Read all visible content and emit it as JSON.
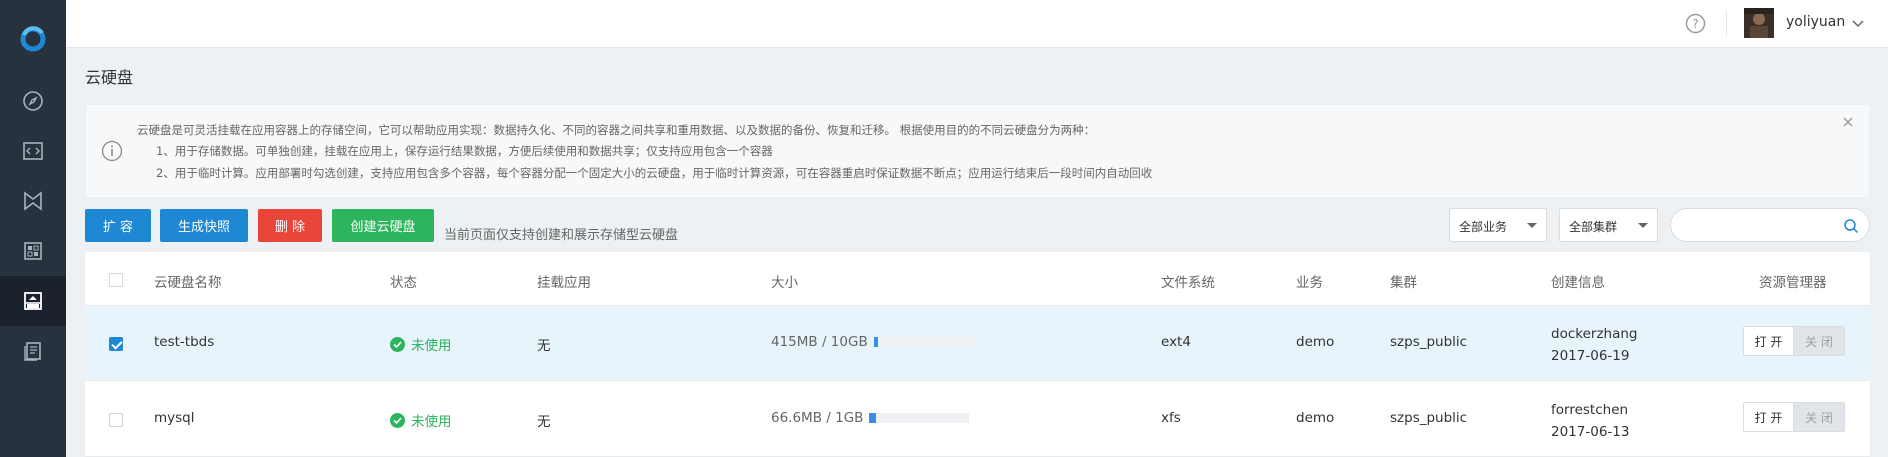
{
  "sidebar": {
    "items": [
      {
        "icon": "compass-icon",
        "active": false
      },
      {
        "icon": "code-icon",
        "active": false
      },
      {
        "icon": "bowtie-icon",
        "active": false
      },
      {
        "icon": "grid-icon",
        "active": false
      },
      {
        "icon": "disk-icon",
        "active": true
      },
      {
        "icon": "document-icon",
        "active": false
      }
    ]
  },
  "header": {
    "username": "yoliyuan"
  },
  "page": {
    "title": "云硬盘"
  },
  "info": {
    "line1": "云硬盘是可灵活挂载在应用容器上的存储空间，它可以帮助应用实现：数据持久化、不同的容器之间共享和重用数据、以及数据的备份、恢复和迁移。 根据使用目的的不同云硬盘分为两种：",
    "line2": "1、用于存储数据。可单独创建，挂载在应用上，保存运行结果数据，方便后续使用和数据共享；仅支持应用包含一个容器",
    "line3": "2、用于临时计算。应用部署时勾选创建，支持应用包含多个容器，每个容器分配一个固定大小的云硬盘，用于临时计算资源，可在容器重启时保证数据不断点；应用运行结束后一段时间内自动回收"
  },
  "toolbar": {
    "expand_label": "扩 容",
    "snapshot_label": "生成快照",
    "delete_label": "删 除",
    "create_label": "创建云硬盘",
    "hint": "当前页面仅支持创建和展示存储型云硬盘",
    "business_select": "全部业务",
    "cluster_select": "全部集群",
    "search_value": ""
  },
  "table": {
    "headers": {
      "name": "云硬盘名称",
      "status": "状态",
      "mount": "挂载应用",
      "size": "大小",
      "fs": "文件系统",
      "business": "业务",
      "cluster": "集群",
      "created": "创建信息",
      "manager": "资源管理器"
    },
    "rows": [
      {
        "checked": true,
        "name": "test-tbds",
        "status": "未使用",
        "mount": "无",
        "size": "415MB / 10GB",
        "usage_fraction": 0.04,
        "fs": "ext4",
        "business": "demo",
        "cluster": "szps_public",
        "creator": "dockerzhang",
        "created_date": "2017-06-19",
        "open_label": "打 开",
        "close_label": "关 闭"
      },
      {
        "checked": false,
        "name": "mysql",
        "status": "未使用",
        "mount": "无",
        "size": "66.6MB / 1GB",
        "usage_fraction": 0.065,
        "fs": "xfs",
        "business": "demo",
        "cluster": "szps_public",
        "creator": "forrestchen",
        "created_date": "2017-06-13",
        "open_label": "打 开",
        "close_label": "关 闭"
      }
    ]
  },
  "colors": {
    "sidebar_bg": "#27323f",
    "primary": "#1e88d4",
    "danger": "#e9453a",
    "success": "#2db55d"
  }
}
